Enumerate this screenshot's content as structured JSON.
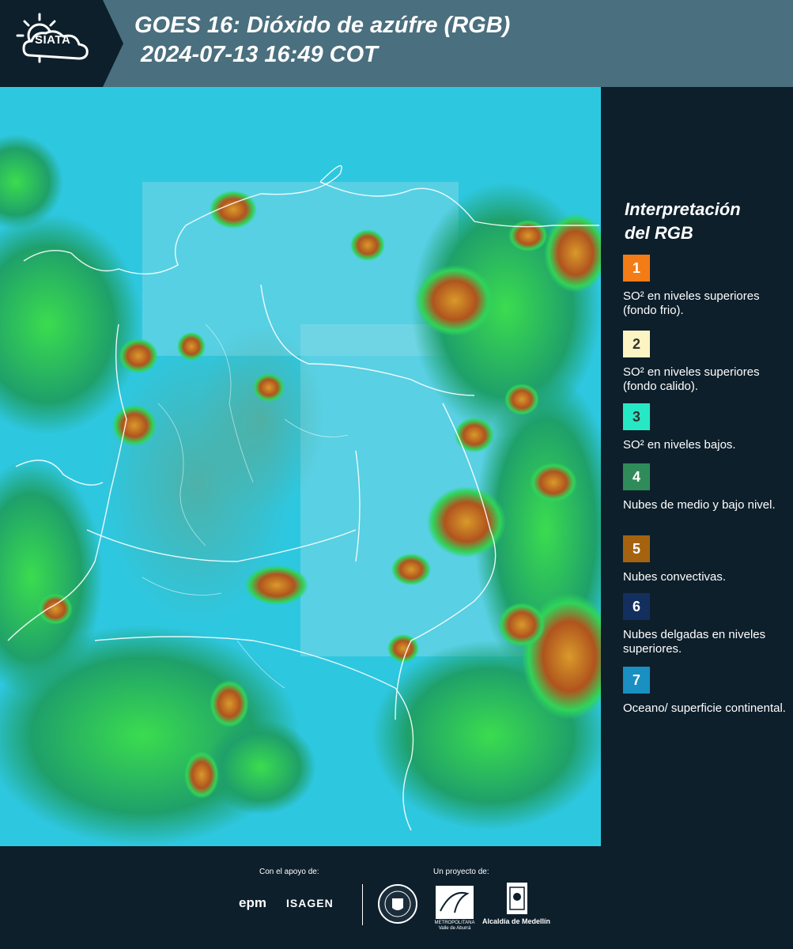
{
  "header": {
    "logo": "SIATA",
    "title_line1": "GOES 16: Dióxido de azúfre (RGB)",
    "title_line2": "2024-07-13 16:49 COT"
  },
  "legend": {
    "title_line1": "Interpretación",
    "title_line2": "del RGB",
    "items": [
      {
        "number": "1",
        "color": "#f47c16",
        "text": "SO² en niveles superiores (fondo frio)."
      },
      {
        "number": "2",
        "color": "#fdf4c4",
        "text": "SO² en niveles superiores (fondo calido)."
      },
      {
        "number": "3",
        "color": "#27e8c5",
        "text": "SO² en niveles bajos."
      },
      {
        "number": "4",
        "color": "#2f8c5a",
        "text": "Nubes de medio y bajo nivel."
      },
      {
        "number": "5",
        "color": "#a5630f",
        "text": "Nubes convectivas."
      },
      {
        "number": "6",
        "color": "#122f5e",
        "text": "Nubes delgadas en niveles superiores."
      },
      {
        "number": "7",
        "color": "#1a8fc1",
        "text": "Oceano/ superficie continental."
      }
    ]
  },
  "footer": {
    "support_label": "Con el apoyo de:",
    "project_label": "Un proyecto de:",
    "sponsor1": "epm",
    "sponsor2": "ISAGEN",
    "amva_text": "METROPOLITANA Valle de Aburrá",
    "alcaldia": "Alcaldía de Medellín"
  }
}
